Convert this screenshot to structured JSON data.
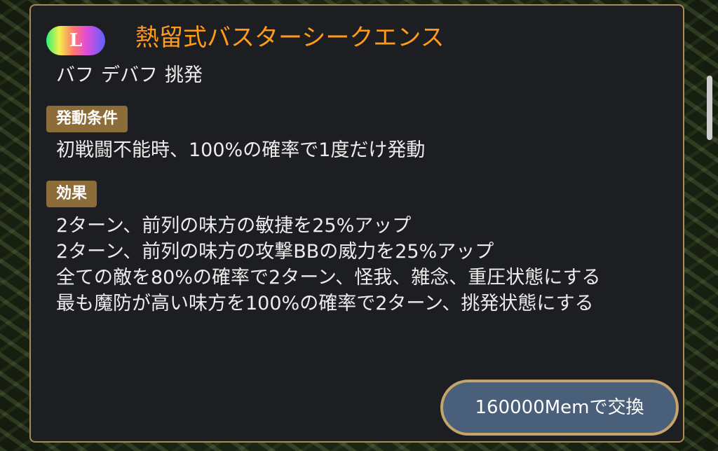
{
  "skill": {
    "rarity": "L",
    "name": "熱留式バスターシークエンス",
    "tags": [
      "バフ",
      "デバフ",
      "挑発"
    ]
  },
  "condition": {
    "label": "発動条件",
    "text": "初戦闘不能時、100%の確率で1度だけ発動"
  },
  "effect": {
    "label": "効果",
    "lines": [
      "2ターン、前列の味方の敏捷を25%アップ",
      "2ターン、前列の味方の攻撃BBの威力を25%アップ",
      "全ての敵を80%の確率で2ターン、怪我、雑念、重圧状態にする",
      "最も魔防が高い味方を100%の確率で2ターン、挑発状態にする"
    ]
  },
  "exchange": {
    "label": "160000Memで交換"
  },
  "colors": {
    "title": "#ff9a1a",
    "section_label_bg": "#8c6c38",
    "panel_bg": "#1c1e21",
    "panel_border": "#a88a55",
    "button_bg": "#4a5f79",
    "button_border": "#c4a46a"
  }
}
